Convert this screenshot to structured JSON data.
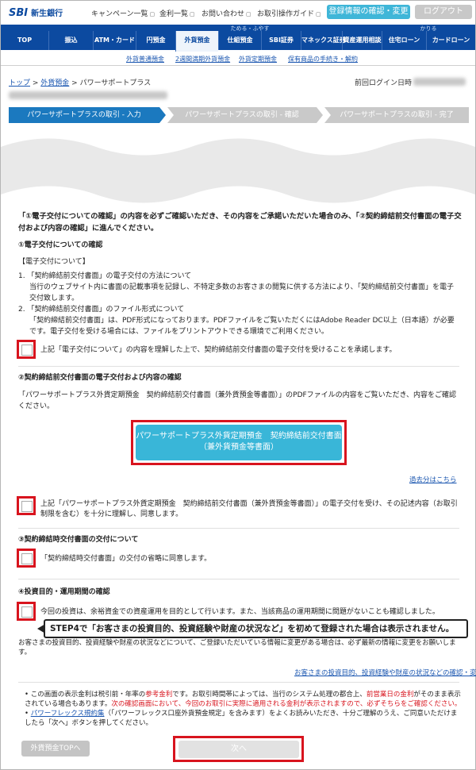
{
  "header": {
    "logo_mark": "SBI",
    "logo_name": "新生銀行",
    "util_links": [
      "キャンペーン一覧",
      "金利一覧",
      "お問い合わせ",
      "お取引操作ガイド"
    ],
    "confirm_button": "登録情報の確認・変更",
    "logout_button": "ログアウト"
  },
  "nav": {
    "group_tame": "ためる・ふやす",
    "group_kariru": "かりる",
    "items": [
      "TOP",
      "振込",
      "ATM・カード",
      "円預金",
      "外貨預金",
      "仕組預金",
      "SBI証券",
      "マネックス証券",
      "資産運用相談",
      "住宅ローン",
      "カードローン"
    ],
    "subitems": [
      "外貨普通預金",
      "2週間満期外貨預金",
      "外貨定期預金",
      "保有商品の手続き・解約"
    ]
  },
  "breadcrumb": {
    "top": "トップ",
    "fx": "外貨預金",
    "current": "パワーサポートプラス"
  },
  "last_login_label": "前回ログイン日時",
  "steps": [
    "パワーサポートプラスの取引 - 入力",
    "パワーサポートプラスの取引 - 確認",
    "パワーサポートプラスの取引 - 完了"
  ],
  "intro": "「①電子交付についての確認」の内容を必ずご確認いただき、その内容をご承諾いただいた場合のみ、「②契約締結前交付書面の電子交付および内容の確認」に進んでください。",
  "sec1": {
    "heading": "①電子交付についての確認",
    "box_title": "【電子交付について】",
    "item1_title": "1. 「契約締結前交付書面」の電子交付の方法について",
    "item1_body": "当行のウェブサイト内に書面の記載事項を記録し、不特定多数のお客さまの閲覧に供する方法により、「契約締結前交付書面」を電子交付致します。",
    "item2_title": "2. 「契約締結前交付書面」のファイル形式について",
    "item2_body": "「契約締結前交付書面」は、PDF形式になっております。PDFファイルをご覧いただくにはAdobe Reader DC以上（日本語）が必要です。電子交付を受ける場合には、ファイルをプリントアウトできる環境でご利用ください。",
    "check": "上記「電子交付について」の内容を理解した上で、契約締結前交付書面の電子交付を受けることを承諾します。"
  },
  "sec2": {
    "heading": "②契約締結前交付書面の電子交付および内容の確認",
    "desc": "「パワーサポートプラス外貨定期預金　契約締結前交付書面（兼外貨預金等書面）」のPDFファイルの内容をご覧いただき、内容をご確認ください。",
    "pdf_line1": "パワーサポートプラス外貨定期預金　契約締結前交付書面",
    "pdf_line2": "（兼外貨預金等書面）",
    "past_link": "過去分はこちら",
    "check": "上記「パワーサポートプラス外貨定期預金　契約締結前交付書面（兼外貨預金等書面）」の電子交付を受け、その記述内容（お取引制限を含む）を十分に理解し、同意します。"
  },
  "sec3": {
    "heading": "③契約締結時交付書面の交付について",
    "check": "「契約締結時交付書面」の交付の省略に同意します。"
  },
  "sec4": {
    "heading": "④投資目的・運用期間の確認",
    "check": "今回の投資は、余裕資金での資産運用を目的として行います。また、当該商品の運用期間に問題がないことも確認しました。",
    "callout": "STEP4で「お客さまの投資目的、投資経験や財産の状況など」を初めて登録された場合は表示されません。",
    "note": "お客さまの投資目的、投資経験や財産の状況などについて、ご登録いただいている情報に変更がある場合は、必ず最新の情報に変更をお願いします。",
    "link": "お客さまの投資目的、投資経験や財産の状況などの確認・変更"
  },
  "notes": {
    "n1_a": "この画面の表示金利は税引前・年率の",
    "n1_b": "参考金利",
    "n1_c": "です。お取引時間帯によっては、当行のシステム処理の都合上、",
    "n1_d": "前営業日の金利",
    "n1_e": "がそのまま表示されている場合もあります。",
    "n1_f": "次の確認画面において、今回のお取引に実際に適用される金利が表示されますので、必ずそちらをご確認ください。",
    "n2_a": "パワーフレックス規約集",
    "n2_b": "（「パワーフレックス口座外貨預金規定」を含みます）をよくお読みいただき、十分ご理解のうえ、ご同意いただけましたら「次へ」ボタンを押してください。"
  },
  "buttons": {
    "back": "外貨預金TOPへ",
    "next": "次へ"
  },
  "colors": {
    "brand_blue": "#0c4aa0",
    "accent_teal": "#39b6d8",
    "highlight_red": "#d8141e"
  }
}
